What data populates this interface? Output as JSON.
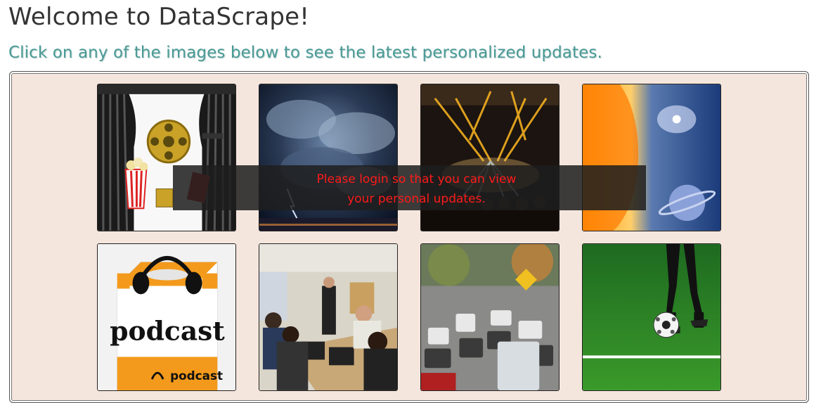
{
  "page": {
    "title": "Welcome to DataScrape!",
    "subtitle": "Click on any of the images below to see the latest personalized updates."
  },
  "tiles": [
    {
      "category": "movies",
      "icon": "cinema-curtain-film-reel"
    },
    {
      "category": "weather",
      "icon": "storm-clouds"
    },
    {
      "category": "concerts",
      "icon": "stage-lights"
    },
    {
      "category": "space",
      "icon": "sun-galaxy-planet"
    },
    {
      "category": "podcast",
      "icon": "podcast-headphones",
      "label_big": "podcast",
      "label_small": "podcast"
    },
    {
      "category": "meetups",
      "icon": "meeting-room"
    },
    {
      "category": "traffic",
      "icon": "highway-traffic"
    },
    {
      "category": "sports",
      "icon": "soccer-ball-player"
    }
  ],
  "login_notice": {
    "line1": "Please login so that you can view",
    "line2": "your personal updates."
  }
}
